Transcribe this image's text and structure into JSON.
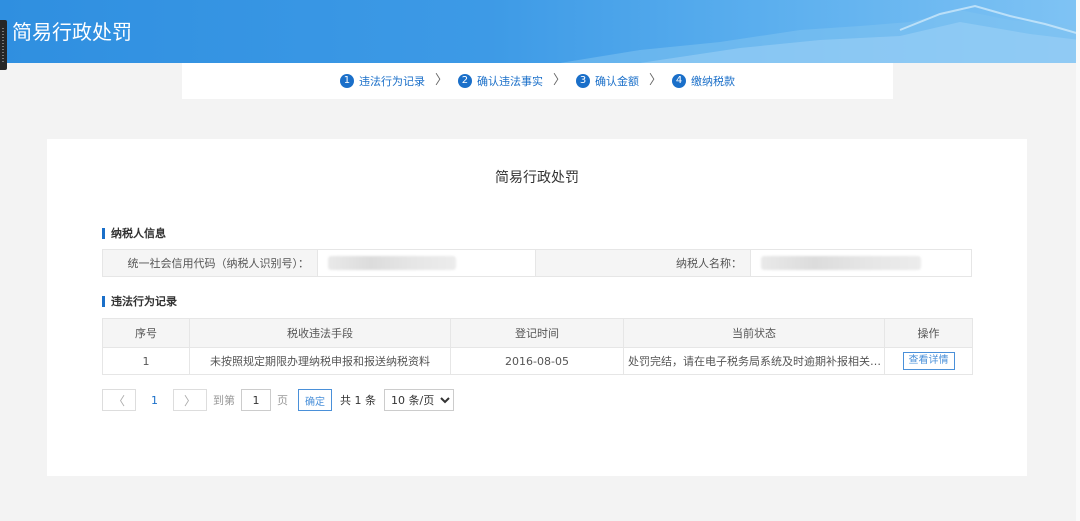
{
  "header": {
    "title": "简易行政处罚"
  },
  "steps": [
    {
      "num": "1",
      "label": "违法行为记录"
    },
    {
      "num": "2",
      "label": "确认违法事实"
    },
    {
      "num": "3",
      "label": "确认金额"
    },
    {
      "num": "4",
      "label": "缴纳税款"
    }
  ],
  "step_separator": "〉",
  "card": {
    "title": "简易行政处罚"
  },
  "taxpayer_section": {
    "title": "纳税人信息",
    "credit_code_label": "统一社会信用代码（纳税人识别号）：",
    "credit_code_value": "",
    "name_label": "纳税人名称：",
    "name_value": ""
  },
  "records_section": {
    "title": "违法行为记录",
    "columns": [
      "序号",
      "税收违法手段",
      "登记时间",
      "当前状态",
      "操作"
    ],
    "rows": [
      {
        "index": "1",
        "method": "未按照规定期限办理纳税申报和报送纳税资料",
        "date": "2016-08-05",
        "status": "处罚完结，请在电子税务局系统及时逾期补报相关资料",
        "action": "查看详情"
      }
    ]
  },
  "pager": {
    "prev": "〈",
    "current": "1",
    "next": "〉",
    "goto_label": "到第",
    "goto_value": "1",
    "page_unit": "页",
    "confirm": "确定",
    "total": "共 1 条",
    "page_size": "10 条/页"
  },
  "colors": {
    "accent": "#1a6fc9",
    "header": "#3d9ae6"
  }
}
